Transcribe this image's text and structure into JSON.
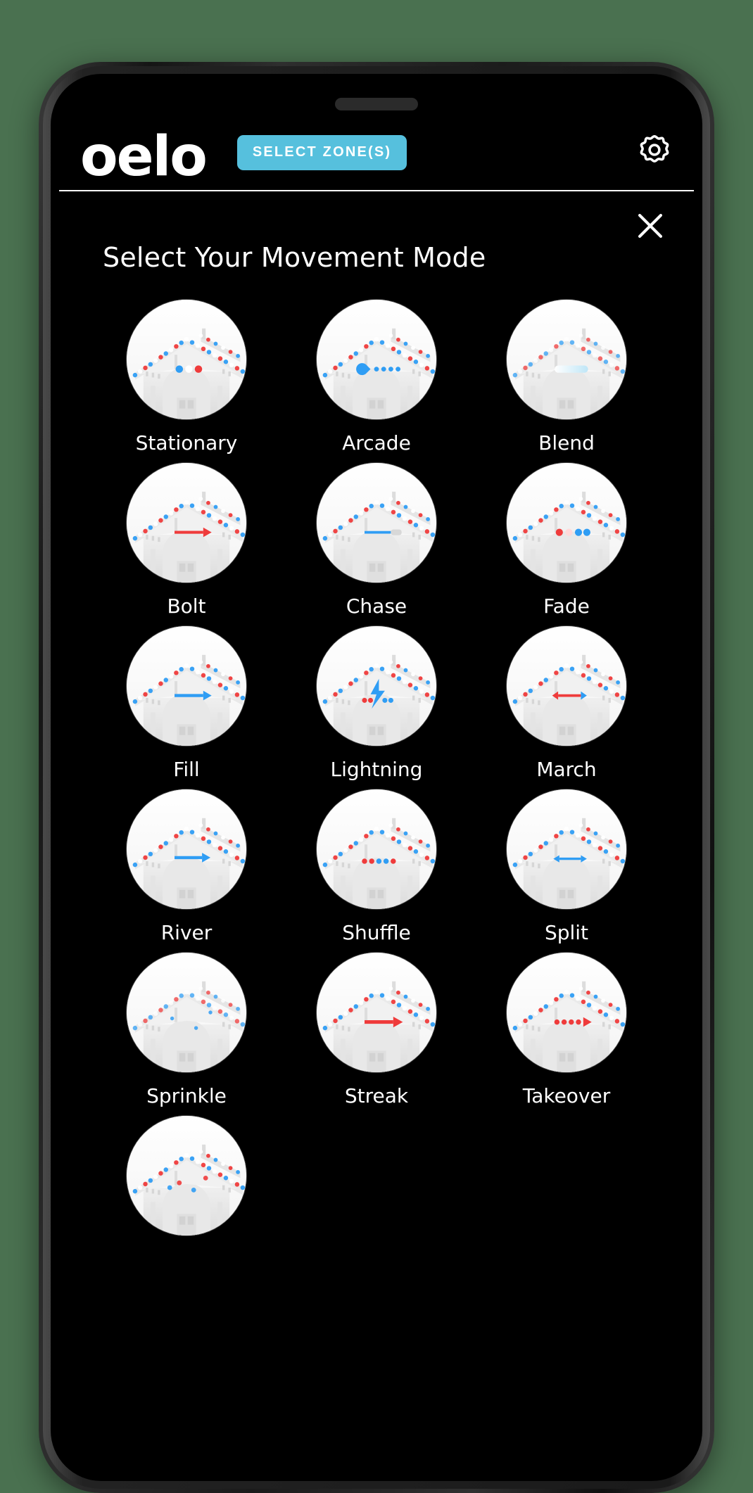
{
  "background_color": "#4a7150",
  "header": {
    "brand": "oelo",
    "select_zones_label": "SELECT ZONE(S)",
    "select_zones_color": "#56c0dd",
    "gear_icon": "gear-icon"
  },
  "panel": {
    "title": "Select Your Movement Mode",
    "close_icon": "close-icon"
  },
  "modes": [
    {
      "label": "Stationary",
      "icon": "house-thumbnail-stationary"
    },
    {
      "label": "Arcade",
      "icon": "house-thumbnail-arcade"
    },
    {
      "label": "Blend",
      "icon": "house-thumbnail-blend"
    },
    {
      "label": "Bolt",
      "icon": "house-thumbnail-bolt"
    },
    {
      "label": "Chase",
      "icon": "house-thumbnail-chase"
    },
    {
      "label": "Fade",
      "icon": "house-thumbnail-fade"
    },
    {
      "label": "Fill",
      "icon": "house-thumbnail-fill"
    },
    {
      "label": "Lightning",
      "icon": "house-thumbnail-lightning"
    },
    {
      "label": "March",
      "icon": "house-thumbnail-march"
    },
    {
      "label": "River",
      "icon": "house-thumbnail-river"
    },
    {
      "label": "Shuffle",
      "icon": "house-thumbnail-shuffle"
    },
    {
      "label": "Split",
      "icon": "house-thumbnail-split"
    },
    {
      "label": "Sprinkle",
      "icon": "house-thumbnail-sprinkle"
    },
    {
      "label": "Streak",
      "icon": "house-thumbnail-streak"
    },
    {
      "label": "Takeover",
      "icon": "house-thumbnail-takeover"
    },
    {
      "label": "",
      "icon": "house-thumbnail-partial"
    }
  ],
  "led_colors": {
    "red": "#ef3b3b",
    "blue": "#2f9df4",
    "white": "#ffffff"
  }
}
